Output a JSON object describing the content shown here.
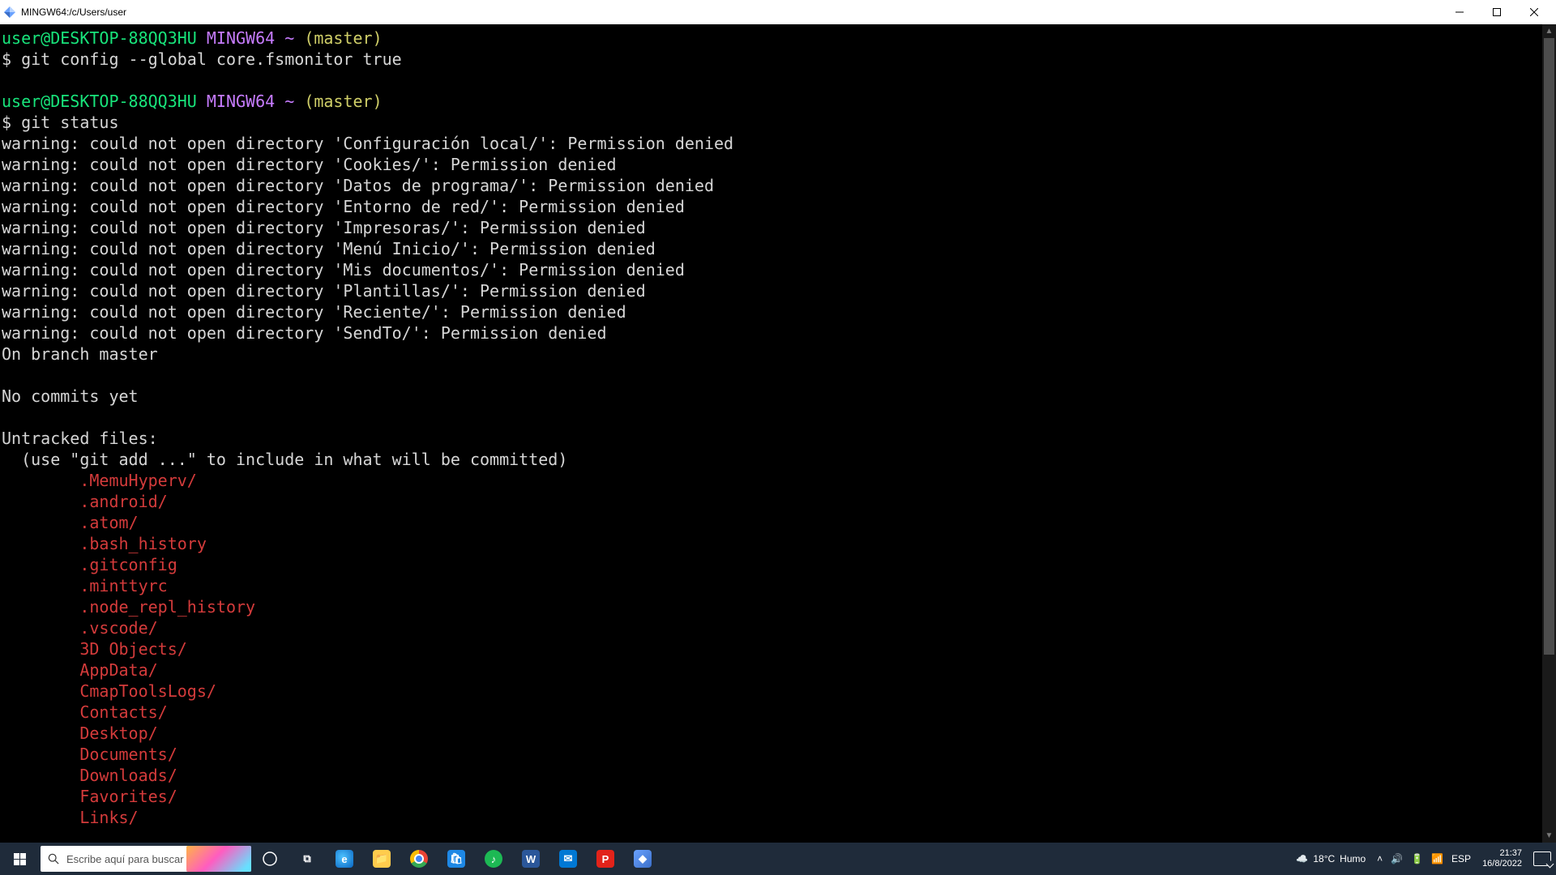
{
  "window": {
    "title": "MINGW64:/c/Users/user"
  },
  "prompt": {
    "user_host": "user@DESKTOP-88QQ3HU",
    "shell": "MINGW64",
    "tilde": "~",
    "branch": "(master)",
    "sigil": "$"
  },
  "cmd1": "git config --global core.fsmonitor true",
  "cmd2": "git status",
  "warnings": [
    "warning: could not open directory 'Configuración local/': Permission denied",
    "warning: could not open directory 'Cookies/': Permission denied",
    "warning: could not open directory 'Datos de programa/': Permission denied",
    "warning: could not open directory 'Entorno de red/': Permission denied",
    "warning: could not open directory 'Impresoras/': Permission denied",
    "warning: could not open directory 'Menú Inicio/': Permission denied",
    "warning: could not open directory 'Mis documentos/': Permission denied",
    "warning: could not open directory 'Plantillas/': Permission denied",
    "warning: could not open directory 'Reciente/': Permission denied",
    "warning: could not open directory 'SendTo/': Permission denied"
  ],
  "status": {
    "on_branch": "On branch master",
    "no_commits": "No commits yet",
    "untracked_hdr": "Untracked files:",
    "untracked_hint": "  (use \"git add <file>...\" to include in what will be committed)"
  },
  "untracked": [
    ".MemuHyperv/",
    ".android/",
    ".atom/",
    ".bash_history",
    ".gitconfig",
    ".minttyrc",
    ".node_repl_history",
    ".vscode/",
    "3D Objects/",
    "AppData/",
    "CmapToolsLogs/",
    "Contacts/",
    "Desktop/",
    "Documents/",
    "Downloads/",
    "Favorites/",
    "Links/"
  ],
  "taskbar": {
    "search_placeholder": "Escribe aquí para buscar",
    "weather_temp": "18°C",
    "weather_desc": "Humo",
    "lang": "ESP",
    "time": "21:37",
    "date": "16/8/2022"
  }
}
